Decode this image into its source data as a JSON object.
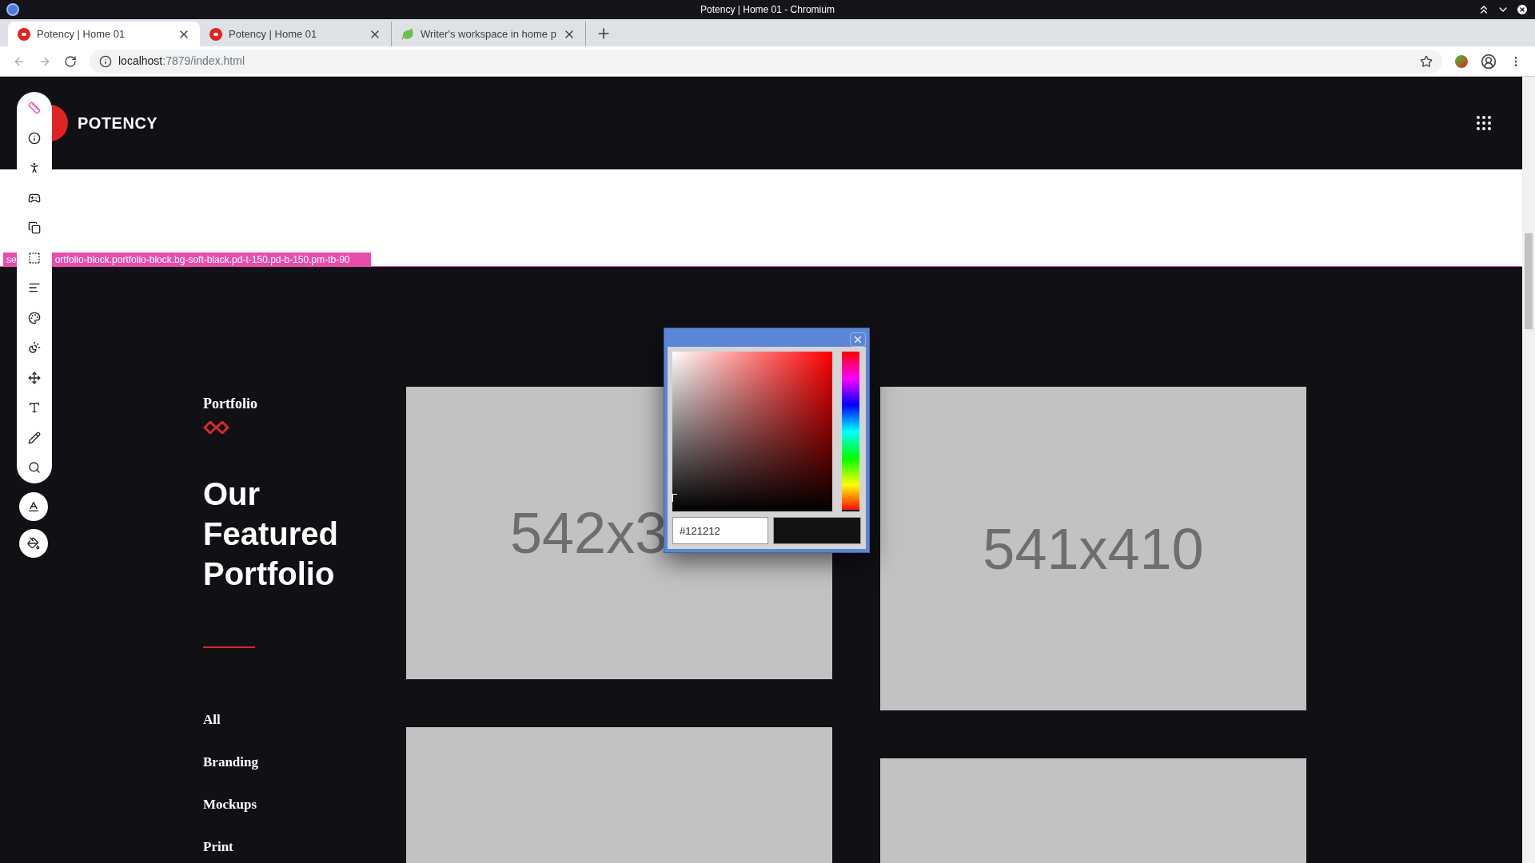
{
  "window": {
    "title": "Potency | Home 01 - Chromium"
  },
  "tabs": [
    {
      "title": "Potency | Home 01",
      "kind": "potency",
      "selected": true
    },
    {
      "title": "Potency | Home 01",
      "kind": "potency",
      "selected": false
    },
    {
      "title": "Writer's workspace in home p",
      "kind": "leaf",
      "selected": false
    }
  ],
  "address": {
    "host": "localhost",
    "path": ":7879/index.html"
  },
  "site": {
    "brand": "POTENCY",
    "selector_label": [
      "se",
      "ortfolio-block.portfolio-block.bg-soft-black.pd-t-150.pd-b-150.pm-tb-90"
    ],
    "eyebrow": "Portfolio",
    "heading": "Our Featured Portfolio",
    "filters": [
      {
        "label": "All"
      },
      {
        "label": "Branding"
      },
      {
        "label": "Mockups"
      },
      {
        "label": "Print"
      }
    ],
    "images": [
      {
        "kind": "placeholder",
        "label": "542x3"
      },
      {
        "kind": "placeholder",
        "label": "541x410"
      },
      {
        "kind": "placeholder"
      },
      {
        "kind": "placeholder"
      }
    ]
  },
  "toolbar": {
    "tools": [
      {
        "kind": "ruler",
        "selected": true
      },
      {
        "kind": "info",
        "selected": false
      },
      {
        "kind": "person",
        "selected": false
      },
      {
        "kind": "cross",
        "selected": false
      },
      {
        "kind": "copy",
        "selected": false
      },
      {
        "kind": "frame",
        "selected": false
      },
      {
        "kind": "align",
        "selected": false
      },
      {
        "kind": "palette",
        "selected": false
      },
      {
        "kind": "contrast",
        "selected": false
      },
      {
        "kind": "move",
        "selected": false
      },
      {
        "kind": "type",
        "selected": false
      },
      {
        "kind": "pencil",
        "selected": false
      },
      {
        "kind": "search",
        "selected": false
      }
    ],
    "buttons": [
      {
        "kind": "text-color"
      },
      {
        "kind": "fill"
      }
    ]
  },
  "color_picker": {
    "value": "#121212",
    "hue": {
      "level": 0
    }
  }
}
